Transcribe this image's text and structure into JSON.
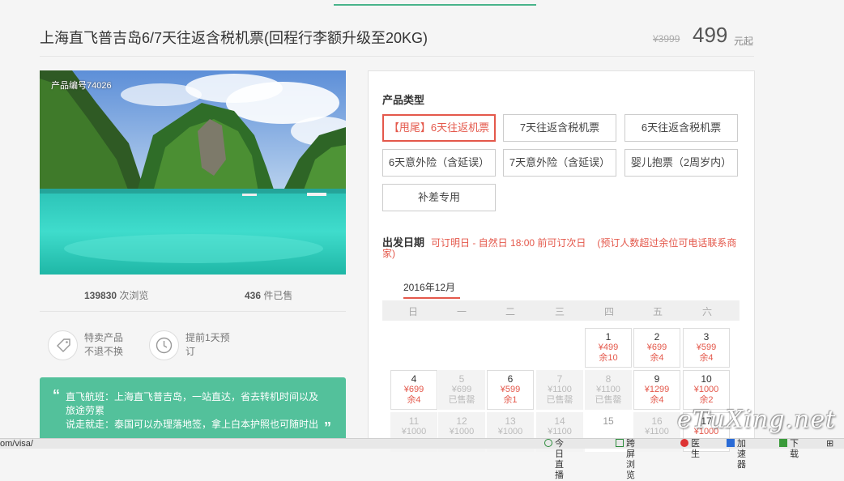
{
  "header": {
    "title": "上海直飞普吉岛6/7天往返含税机票(回程行李额升级至20KG)",
    "price_old": "¥3999",
    "price_now": "499",
    "price_unit": "元起"
  },
  "photo": {
    "product_code": "产品编号74026"
  },
  "stats": {
    "views_num": "139830",
    "views_label": " 次浏览",
    "sold_num": "436",
    "sold_label": " 件已售"
  },
  "features": [
    {
      "icon": "tag-icon",
      "line1": "特卖产品",
      "line2": "不退不换"
    },
    {
      "icon": "clock-icon",
      "line1": "提前1天预",
      "line2": "订"
    }
  ],
  "promo": {
    "line1": "直飞航班：上海直飞普吉岛，一站直达，省去转机时间以及",
    "line2": "旅途劳累",
    "line3": "说走就走：泰国可以办理落地签，拿上白本护照也可随时出"
  },
  "booking": {
    "type_title": "产品类型",
    "options": [
      "【甩尾】6天往返机票",
      "7天往返含税机票",
      "6天往返含税机票",
      "6天意外险（含延误）",
      "7天意外险（含延误）",
      "婴儿抱票（2周岁内）",
      "补差专用"
    ],
    "date_label": "出发日期",
    "date_note": "可订明日 - 自然日 18:00 前可订次日",
    "date_paren": "(预订人数超过余位可电话联系商家)",
    "month": "2016年12月",
    "weekdays": [
      "日",
      "一",
      "二",
      "三",
      "四",
      "五",
      "六"
    ],
    "days": [
      {
        "d": "1",
        "p": "¥499",
        "r": "余10",
        "state": "open"
      },
      {
        "d": "2",
        "p": "¥699",
        "r": "余4",
        "state": "open"
      },
      {
        "d": "3",
        "p": "¥599",
        "r": "余4",
        "state": "open"
      },
      {
        "d": "4",
        "p": "¥699",
        "r": "余4",
        "state": "open"
      },
      {
        "d": "5",
        "p": "¥699",
        "r": "已售罄",
        "state": "dis"
      },
      {
        "d": "6",
        "p": "¥599",
        "r": "余1",
        "state": "open"
      },
      {
        "d": "7",
        "p": "¥1100",
        "r": "已售罄",
        "state": "dis"
      },
      {
        "d": "8",
        "p": "¥1100",
        "r": "已售罄",
        "state": "dis"
      },
      {
        "d": "9",
        "p": "¥1299",
        "r": "余4",
        "state": "open"
      },
      {
        "d": "10",
        "p": "¥1000",
        "r": "余2",
        "state": "open"
      },
      {
        "d": "11",
        "p": "¥1000",
        "r": "",
        "state": "dis"
      },
      {
        "d": "12",
        "p": "¥1000",
        "r": "",
        "state": "dis"
      },
      {
        "d": "13",
        "p": "¥1000",
        "r": "",
        "state": "dis"
      },
      {
        "d": "14",
        "p": "¥1100",
        "r": "",
        "state": "dis"
      },
      {
        "d": "15",
        "p": "",
        "r": "",
        "state": "plain"
      },
      {
        "d": "16",
        "p": "¥1100",
        "r": "",
        "state": "dis"
      },
      {
        "d": "17",
        "p": "¥1000",
        "r": "",
        "state": "open"
      }
    ]
  },
  "watermark": "eTuXing.net",
  "statusbar": {
    "url": "om/visa/",
    "items": [
      "今日直播",
      "跨屏浏览",
      "医生",
      "加速器",
      "下载"
    ]
  },
  "colors": {
    "accent": "#e4584b",
    "green": "#53c19b",
    "sea": "#33d3c4"
  }
}
